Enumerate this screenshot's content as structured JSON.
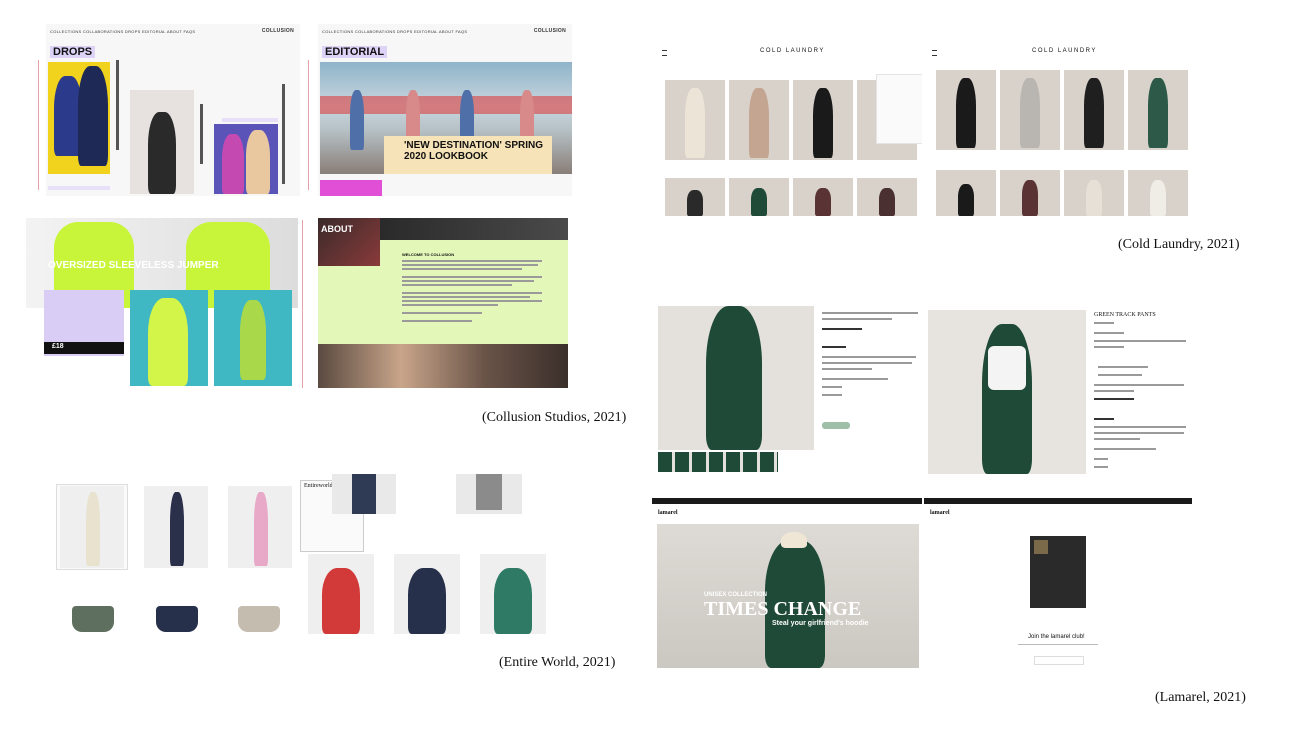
{
  "collusion": {
    "caption": "(Collusion Studios, 2021)",
    "nav_left": "COLLECTIONS   COLLABORATIONS   DROPS   EDITORIAL   ABOUT   FAQS",
    "brand": "COLLUSION",
    "drops_label": "DROPS",
    "editorial_label": "EDITORIAL",
    "lookbook_title": "'NEW DESTINATION' SPRING 2020 LOOKBOOK",
    "jumper_title": "OVERSIZED SLEEVELESS JUMPER",
    "price": "£18",
    "about_label": "ABOUT",
    "about_heading": "WELCOME TO COLLUSION"
  },
  "cold_laundry": {
    "caption": "(Cold Laundry, 2021)",
    "brand": "COLD LAUNDRY",
    "product_title": "GREEN TRACK PANTS"
  },
  "entire_world": {
    "caption": "(Entire World, 2021)",
    "brand": "Entireworld"
  },
  "lamarel": {
    "caption": "(Lamarel, 2021)",
    "brand": "lamarel",
    "hero_small": "UNISEX COLLECTION",
    "hero_title": "TIMES CHANGE",
    "hero_sub": "Steal your girlfriend's hoodie",
    "club_heading": "Join the lamarel club!"
  },
  "colors": {
    "drops_yellow": "#f1d21c",
    "lime": "#c8f53a",
    "teal": "#3fb8c4",
    "lavender": "#d9cdf5",
    "pale_green": "#e2f7b8",
    "forest_green": "#1f4a38",
    "label_bg": "#dcd3f7"
  }
}
